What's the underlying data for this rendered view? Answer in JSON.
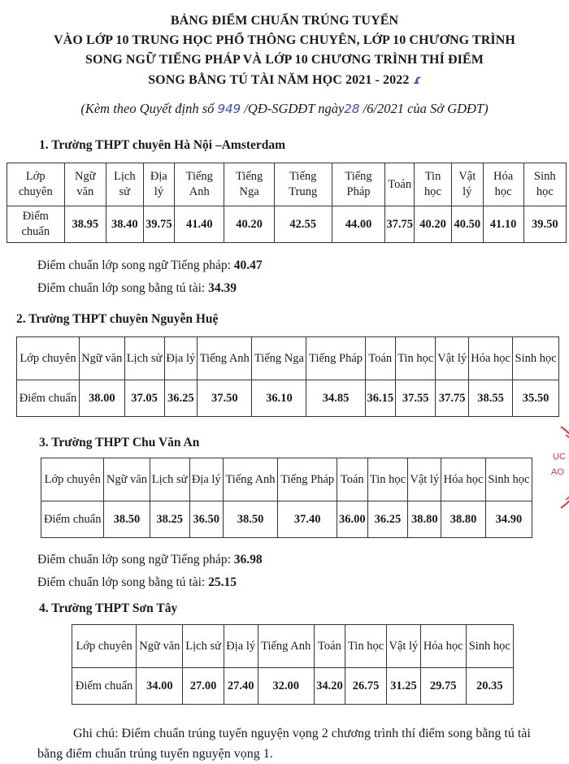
{
  "document": {
    "title_lines": [
      "BẢNG ĐIỂM CHUẨN TRÚNG TUYỂN",
      "VÀO LỚP 10 TRUNG HỌC PHỔ THÔNG CHUYÊN, LỚP 10 CHƯƠNG TRÌNH",
      "SONG NGỮ TIẾNG PHÁP VÀ LỚP 10 CHƯƠNG TRÌNH THÍ ĐIỂM",
      "SONG BẰNG TÚ TÀI NĂM HỌC 2021 - 2022"
    ],
    "subtitle": {
      "prefix": "(Kèm theo Quyết định số",
      "decision_no": "949",
      "middle": "/QĐ-SGDĐT ngày",
      "day": "28",
      "suffix": "/6/2021 của Sở GDĐT)"
    },
    "row_header_label": "Lớp chuyên",
    "row_value_label": "Điểm chuẩn",
    "schools": [
      {
        "heading": "1. Trường THPT chuyên Hà Nội –Amsterdam",
        "subjects": [
          "Ngữ văn",
          "Lịch sử",
          "Địa lý",
          "Tiếng Anh",
          "Tiếng Nga",
          "Tiếng Trung",
          "Tiếng Pháp",
          "Toán",
          "Tin học",
          "Vật lý",
          "Hóa học",
          "Sinh học"
        ],
        "scores": [
          "38.95",
          "38.40",
          "39.75",
          "41.40",
          "40.20",
          "42.55",
          "44.00",
          "37.75",
          "40.20",
          "40.50",
          "41.10",
          "39.50"
        ],
        "notes": [
          {
            "label": "Điểm chuẩn lớp song ngữ Tiếng pháp: ",
            "value": "40.47"
          },
          {
            "label": "Điểm chuẩn lớp song bằng tú tài: ",
            "value": "34.39"
          }
        ]
      },
      {
        "heading": "2. Trường THPT chuyên Nguyễn Huệ",
        "subjects": [
          "Ngữ văn",
          "Lịch sử",
          "Địa lý",
          "Tiếng Anh",
          "Tiếng Nga",
          "Tiếng Pháp",
          "Toán",
          "Tin học",
          "Vật lý",
          "Hóa học",
          "Sinh học"
        ],
        "scores": [
          "38.00",
          "37.05",
          "36.25",
          "37.50",
          "36.10",
          "34.85",
          "36.15",
          "37.55",
          "37.75",
          "38.55",
          "35.50"
        ],
        "notes": []
      },
      {
        "heading": "3. Trường THPT Chu Văn An",
        "subjects": [
          "Ngữ văn",
          "Lịch sử",
          "Địa lý",
          "Tiếng Anh",
          "Tiếng Pháp",
          "Toán",
          "Tin học",
          "Vật lý",
          "Hóa học",
          "Sinh học"
        ],
        "scores": [
          "38.50",
          "38.25",
          "36.50",
          "38.50",
          "37.40",
          "36.00",
          "36.25",
          "38.80",
          "38.80",
          "34.90"
        ],
        "notes": [
          {
            "label": "Điểm chuẩn lớp song ngữ Tiếng pháp: ",
            "value": "36.98"
          },
          {
            "label": "Điểm chuẩn lớp song bằng tú tài: ",
            "value": "25.15"
          }
        ]
      },
      {
        "heading": "4. Trường THPT Sơn Tây",
        "subjects": [
          "Ngữ văn",
          "Lịch sử",
          "Địa lý",
          "Tiếng Anh",
          "Toán",
          "Tin học",
          "Vật lý",
          "Hóa học",
          "Sinh học"
        ],
        "scores": [
          "34.00",
          "27.00",
          "27.40",
          "32.00",
          "34.20",
          "26.75",
          "31.25",
          "29.75",
          "20.35"
        ],
        "notes": []
      }
    ],
    "footnote": "Ghi chú: Điểm chuẩn trúng tuyển nguyện vọng 2 chương trình thí điểm song bằng tú tài bằng điểm chuẩn trúng tuyển nguyện vọng 1.",
    "stamp_text": "ỤC ẠO HÀ NỘI",
    "colors": {
      "stamp": "#d83a3a",
      "handwriting": "#3a4fb8"
    }
  }
}
